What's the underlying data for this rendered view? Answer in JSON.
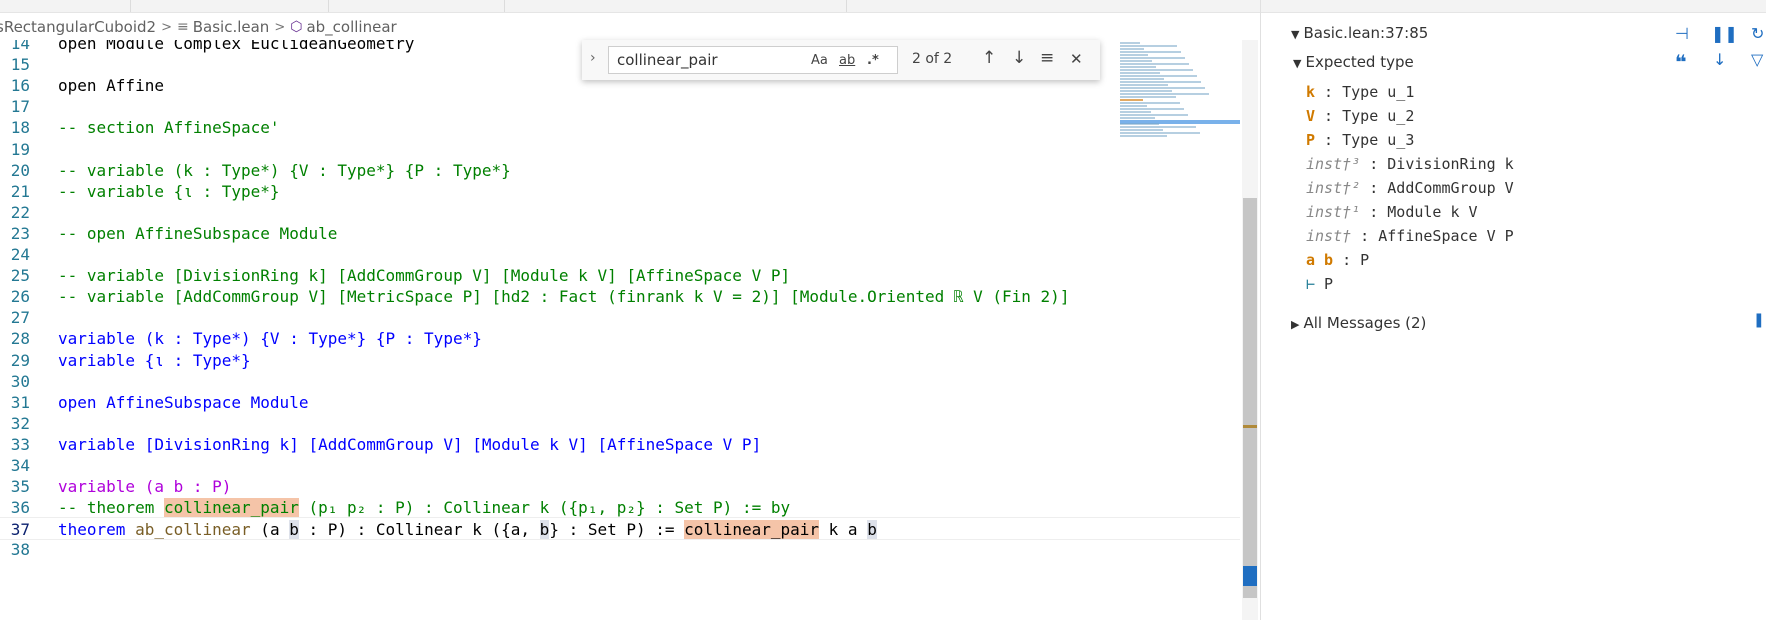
{
  "breadcrumb": {
    "items": [
      "sRectangularCuboid2",
      "Basic.lean",
      "ab_collinear"
    ],
    "sep": ">",
    "file_icon": "≡",
    "symbol_icon": "⬡"
  },
  "editor": {
    "lines": [
      {
        "n": "14",
        "text": "open Module Complex EuclideanGeometry",
        "style": "kw"
      },
      {
        "n": "15",
        "text": "",
        "style": ""
      },
      {
        "n": "16",
        "text": "open Affine",
        "style": ""
      },
      {
        "n": "17",
        "text": "",
        "style": ""
      },
      {
        "n": "18",
        "text": "-- section AffineSpace'",
        "style": "cmt"
      },
      {
        "n": "19",
        "text": "",
        "style": ""
      },
      {
        "n": "20",
        "text": "-- variable (k : Type*) {V : Type*} {P : Type*}",
        "style": "cmt"
      },
      {
        "n": "21",
        "text": "-- variable {ι : Type*}",
        "style": "cmt"
      },
      {
        "n": "22",
        "text": "",
        "style": ""
      },
      {
        "n": "23",
        "text": "-- open AffineSubspace Module",
        "style": "cmt"
      },
      {
        "n": "24",
        "text": "",
        "style": ""
      },
      {
        "n": "25",
        "text": "-- variable [DivisionRing k] [AddCommGroup V] [Module k V] [AffineSpace V P]",
        "style": "cmt"
      },
      {
        "n": "26",
        "text": "-- variable [AddCommGroup V] [MetricSpace P] [hd2 : Fact (finrank k V = 2)] [Module.Oriented ℝ V (Fin 2)]",
        "style": "cmt"
      },
      {
        "n": "27",
        "text": "",
        "style": ""
      },
      {
        "n": "28",
        "text": "",
        "style": "var28"
      },
      {
        "n": "29",
        "text": "",
        "style": "var29"
      },
      {
        "n": "30",
        "text": "",
        "style": ""
      },
      {
        "n": "31",
        "text": "open AffineSubspace Module",
        "style": "open31"
      },
      {
        "n": "32",
        "text": "",
        "style": ""
      },
      {
        "n": "33",
        "text": "",
        "style": "var33"
      },
      {
        "n": "34",
        "text": "",
        "style": ""
      },
      {
        "n": "35",
        "text": "variable (a b : P)",
        "style": "var35"
      },
      {
        "n": "36",
        "text": "",
        "style": "l36"
      },
      {
        "n": "37",
        "text": "",
        "style": "l37"
      },
      {
        "n": "38",
        "text": "",
        "style": ""
      }
    ],
    "l28": {
      "kw": "variable",
      "rest": " (k : Type*) {V : Type*} {P : Type*}"
    },
    "l29": {
      "kw": "variable",
      "rest": " {ι : Type*}"
    },
    "l33": {
      "kw": "variable",
      "rest": " [DivisionRing k] [AddCommGroup V] [Module k V] [AffineSpace V P]"
    },
    "l36": {
      "pre": "-- theorem ",
      "hl": "collinear_pair",
      "post": " (p₁ p₂ : P) : Collinear k ({p₁, p₂} : Set P) := by"
    },
    "l37": {
      "kw": "theorem",
      "name": " ab_collinear",
      "a": " (a ",
      "b": "b",
      "mid": " : P) : Collinear k ({a, ",
      "b2": "b",
      "mid2": "} : Set P) := ",
      "hl": "collinear_pair",
      "end": " k a ",
      "b3": "b"
    }
  },
  "find": {
    "value": "collinear_pair",
    "match_case": "Aa",
    "whole_word": "ab",
    "regex": ".*",
    "count": "2 of 2",
    "prev_icon": "↑",
    "next_icon": "↓",
    "selection_icon": "≡",
    "close_icon": "✕",
    "toggle_icon": "›"
  },
  "infoview": {
    "location": "Basic.lean:37:85",
    "expected_type_label": "Expected type",
    "goals": [
      {
        "name": "k",
        "type": " : Type u_1",
        "kind": "var"
      },
      {
        "name": "V",
        "type": " : Type u_2",
        "kind": "var"
      },
      {
        "name": "P",
        "type": " : Type u_3",
        "kind": "var"
      },
      {
        "name": "inst†³",
        "type": " : DivisionRing k",
        "kind": "inst"
      },
      {
        "name": "inst†²",
        "type": " : AddCommGroup V",
        "kind": "inst"
      },
      {
        "name": "inst†¹",
        "type": " : Module k V",
        "kind": "inst"
      },
      {
        "name": "inst†",
        "type": " : AffineSpace V P",
        "kind": "inst"
      },
      {
        "name": "a b",
        "type": " : P",
        "kind": "var"
      }
    ],
    "turnstile": "⊢",
    "goal_type": " P",
    "all_messages": "All Messages (2)"
  }
}
